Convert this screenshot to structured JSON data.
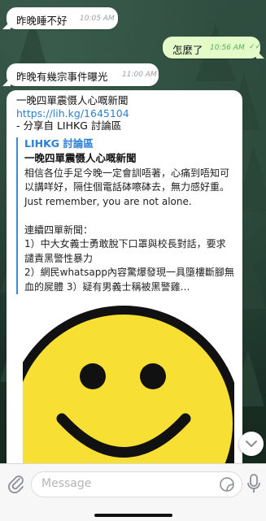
{
  "messages": [
    {
      "text": "昨晚睡不好",
      "time": "10:05 AM",
      "direction": "in"
    },
    {
      "text": "怎麼了",
      "time": "10:56 AM",
      "direction": "out",
      "status": "read"
    },
    {
      "text": "昨晚有幾宗事件曝光",
      "time": "11:00 AM",
      "direction": "in"
    }
  ],
  "shared": {
    "headline": "一晚四單震慑人心嘅新聞",
    "url": "https://lih.kg/1645104",
    "source": "- 分享自 LIHKG 討論區",
    "preview": {
      "site": "LIHKG 討論區",
      "title": "一晚四單震慑人心嘅新聞",
      "body": "相信各位手足今晚一定會訓唔著，心痛到唔知可以講咩好，隔住個電話砵嚓砵去，無力感好重。Just remember, you are not alone.\n\n連續四單新聞：\n1）中大女義士勇敢脫下口罩與校長對話，要求譴責黑警性暴力\n2）網民whatsapp內容驚爆發現一具墮樓斷腳無血的屍體 3）疑有男義士稱被黑警雞…"
    }
  },
  "input": {
    "placeholder": "Message"
  },
  "icons": {
    "attach": "paperclip-icon",
    "sticker": "sticker-icon",
    "mic": "microphone-icon",
    "scroll": "chevron-down-icon",
    "read_status": "double-check-icon"
  },
  "colors": {
    "outgoing_bubble": "#e2fbc9",
    "incoming_bubble": "#ffffff",
    "link": "#2a7fd4",
    "smiley": "#f7e033"
  }
}
